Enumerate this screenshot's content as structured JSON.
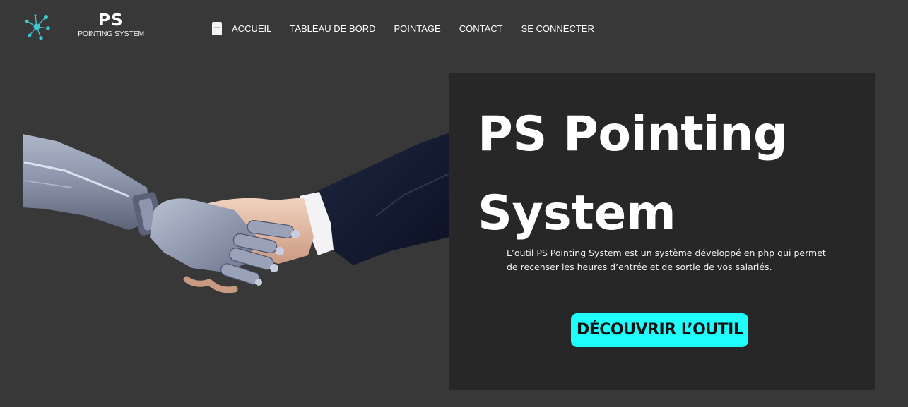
{
  "brand": {
    "mark": "PS",
    "name": "POINTING SYSTEM",
    "accent": "#3fc6d3"
  },
  "nav": {
    "items": [
      {
        "label": "ACCUEIL"
      },
      {
        "label": "TABLEAU DE BORD"
      },
      {
        "label": "POINTAGE"
      },
      {
        "label": "CONTACT"
      },
      {
        "label": "SE CONNECTER"
      }
    ]
  },
  "hero": {
    "title": "PS Pointing System",
    "description": "L’outil PS Pointing System est un système développé en php qui permet de recenser les heures d’entrée et de sortie de vos salariés.",
    "cta_label": "DÉCOUVRIR L’OUTIL",
    "cta_color": "#20fdfd",
    "image": "robot-human-handshake"
  },
  "colors": {
    "page_bg": "#383838",
    "panel_bg": "#272727"
  }
}
